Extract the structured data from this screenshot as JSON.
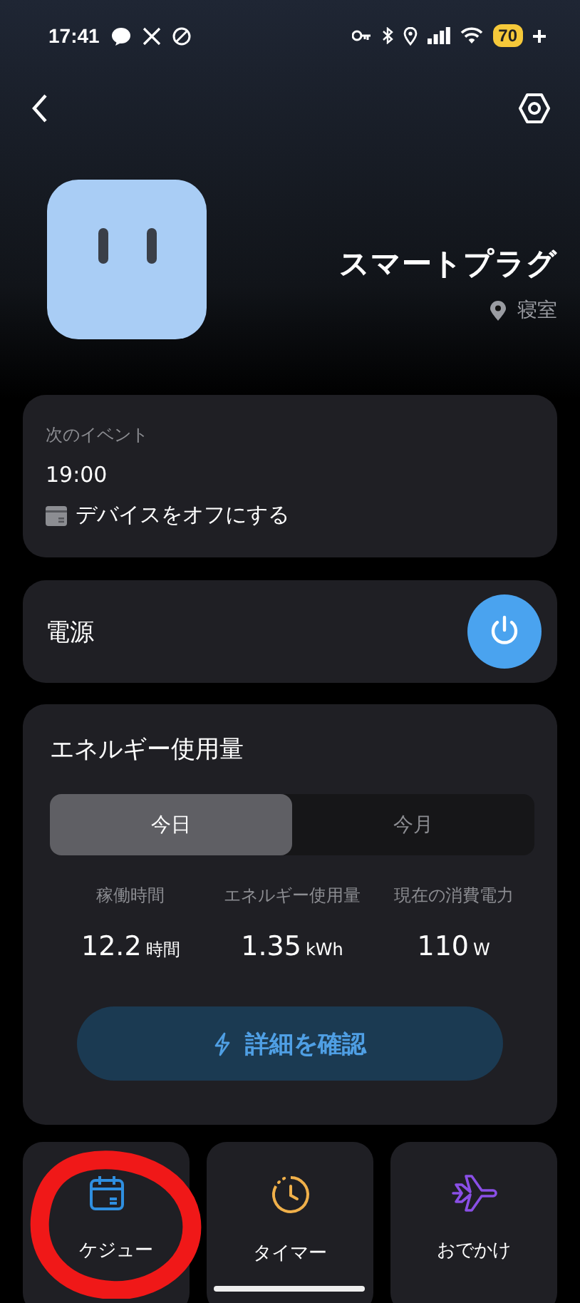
{
  "status_bar": {
    "time": "17:41",
    "battery": "70"
  },
  "header": {
    "title": "スマートプラグ",
    "location": "寝室"
  },
  "next_event": {
    "label": "次のイベント",
    "time": "19:00",
    "action": "デバイスをオフにする"
  },
  "power": {
    "label": "電源",
    "on": true
  },
  "energy": {
    "title": "エネルギー使用量",
    "tabs": [
      {
        "label": "今日",
        "selected": true
      },
      {
        "label": "今月",
        "selected": false
      }
    ],
    "stats": [
      {
        "label": "稼働時間",
        "value": "12.2",
        "unit": "時間"
      },
      {
        "label": "エネルギー使用量",
        "value": "1.35",
        "unit": "kWh"
      },
      {
        "label": "現在の消費電力",
        "value": "110",
        "unit": "W"
      }
    ],
    "details_button": "詳細を確認"
  },
  "shortcuts": [
    {
      "kind": "schedule",
      "label": "ケジュー"
    },
    {
      "kind": "timer",
      "label": "タイマー"
    },
    {
      "kind": "away",
      "label": "おでかけ"
    }
  ]
}
